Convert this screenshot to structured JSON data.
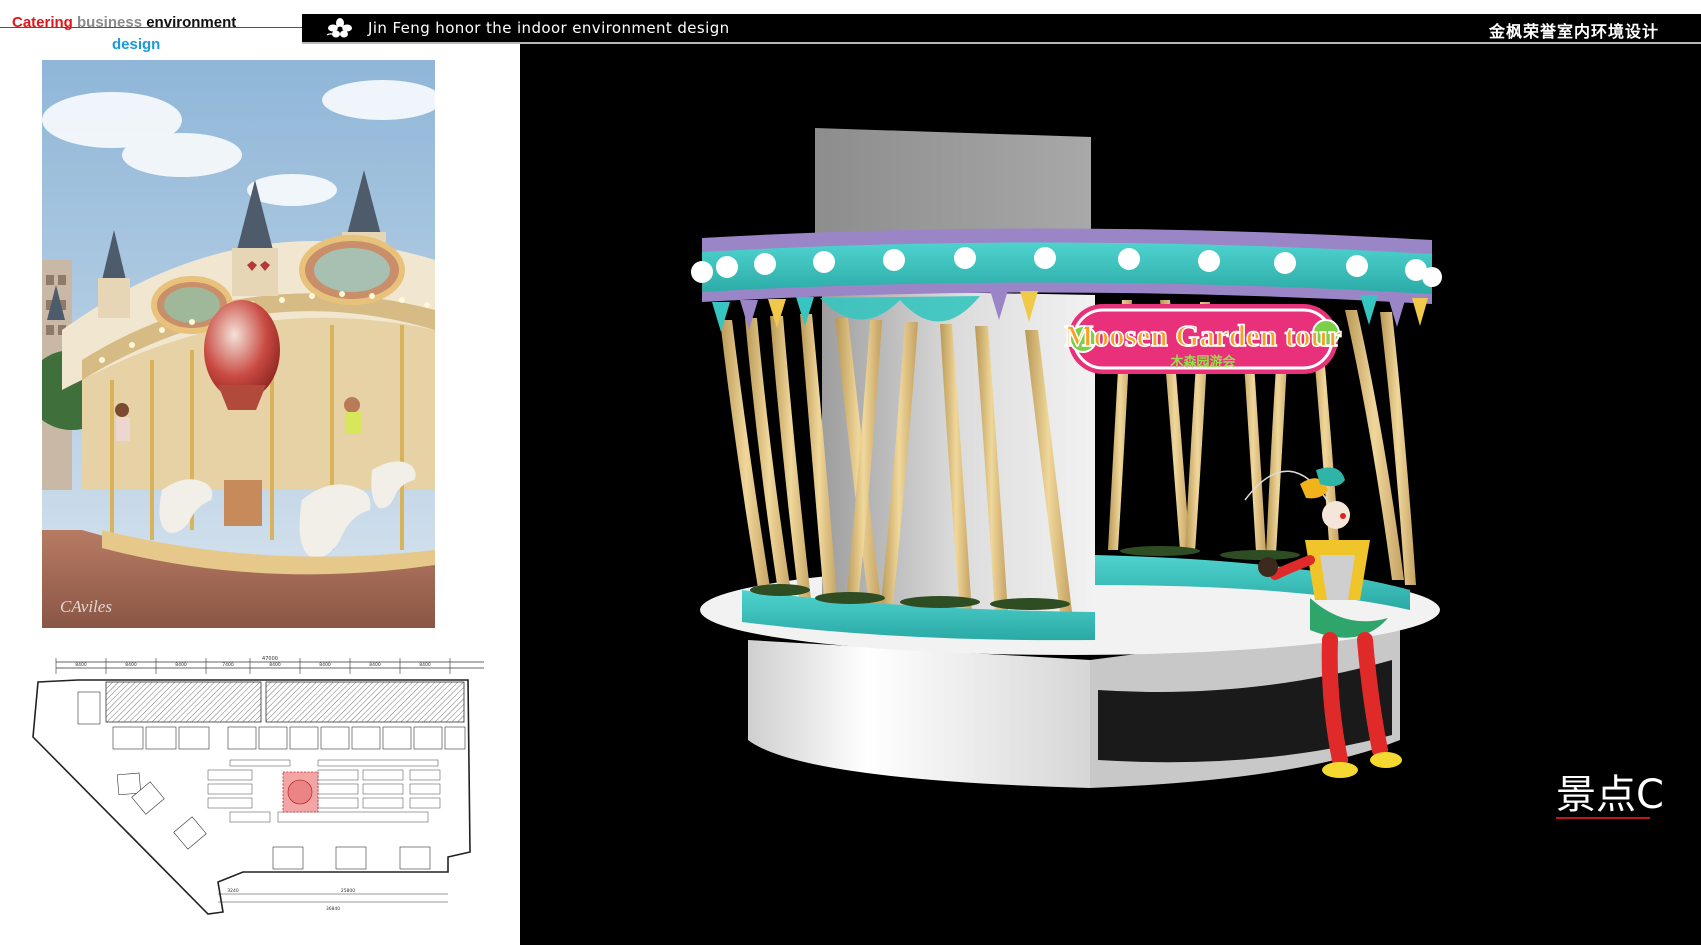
{
  "header": {
    "left_title_word1": "Catering",
    "left_title_word2": "business",
    "left_title_word3": "environment",
    "left_title_line2": "design",
    "en_title": "Jin Feng honor the indoor environment design",
    "cn_title": "金枫荣誉室内环境设计"
  },
  "photo": {
    "credit": "CAviles"
  },
  "render": {
    "sign_main": "Moosen Garden tour",
    "sign_sub": "木森园游会",
    "viewpoint_label": "景点C"
  },
  "floor_plan": {
    "top_dim": "47000",
    "segment_dims": [
      "8400",
      "8400",
      "8400",
      "7400",
      "8400",
      "8400",
      "8400",
      "8400"
    ],
    "bottom_dims": [
      "3240",
      "25800"
    ],
    "bottom_total": "36840"
  },
  "colors": {
    "accent_red": "#e0161b",
    "accent_blue": "#1a9ad6",
    "teal": "#36c5c0",
    "lavender": "#9a86c6",
    "sign_pink": "#e8317a"
  }
}
